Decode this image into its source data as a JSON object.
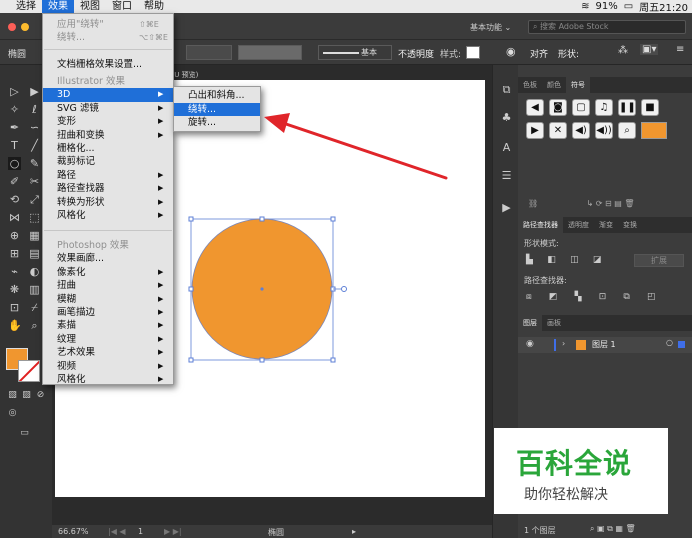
{
  "menubar": {
    "items": [
      "选择",
      "效果",
      "视图",
      "窗口",
      "帮助"
    ],
    "status": {
      "battery": "91%",
      "clock": "周五21:20"
    }
  },
  "titlebar": {
    "workspace": "基本功能 ⌄",
    "search_placeholder": "搜索 Adobe Stock"
  },
  "controlbar": {
    "tool_name": "椭圆",
    "stroke_style": "基本",
    "opacity_label": "不透明度",
    "style_label": "样式:",
    "align_label": "对齐",
    "shape_label": "形状:"
  },
  "doc_tab": "PU 预览)",
  "effect_menu": {
    "items": [
      {
        "label": "应用\"绕转\"",
        "shortcut": "⇧⌘E",
        "disabled": true
      },
      {
        "label": "绕转...",
        "shortcut": "⌥⇧⌘E",
        "disabled": true
      },
      {
        "label": "文档栅格效果设置..."
      },
      {
        "label": "Illustrator 效果",
        "disabled": true
      },
      {
        "label": "3D",
        "submenu": true,
        "highlighted": true
      },
      {
        "label": "SVG 滤镜",
        "submenu": true
      },
      {
        "label": "变形",
        "submenu": true
      },
      {
        "label": "扭曲和变换",
        "submenu": true
      },
      {
        "label": "栅格化..."
      },
      {
        "label": "裁剪标记"
      },
      {
        "label": "路径",
        "submenu": true
      },
      {
        "label": "路径查找器",
        "submenu": true
      },
      {
        "label": "转换为形状",
        "submenu": true
      },
      {
        "label": "风格化",
        "submenu": true
      },
      {
        "label": "Photoshop 效果",
        "disabled": true
      },
      {
        "label": "效果画廊..."
      },
      {
        "label": "像素化",
        "submenu": true
      },
      {
        "label": "扭曲",
        "submenu": true
      },
      {
        "label": "模糊",
        "submenu": true
      },
      {
        "label": "画笔描边",
        "submenu": true
      },
      {
        "label": "素描",
        "submenu": true
      },
      {
        "label": "纹理",
        "submenu": true
      },
      {
        "label": "艺术效果",
        "submenu": true
      },
      {
        "label": "视频",
        "submenu": true
      },
      {
        "label": "风格化",
        "submenu": true
      }
    ]
  },
  "submenu_3d": {
    "items": [
      {
        "label": "凸出和斜角..."
      },
      {
        "label": "绕转...",
        "highlighted": true
      },
      {
        "label": "旋转..."
      }
    ]
  },
  "artwork": {
    "fill": "#F0962F",
    "stroke": "#7a86b8"
  },
  "fill_swatch": "#F0962F",
  "panels": {
    "top_tabs": [
      "色板",
      "颜色",
      "符号"
    ],
    "pathfinder_tabs": [
      "路径查找器",
      "透明度",
      "渐变",
      "变换"
    ],
    "shape_modes_label": "形状模式:",
    "expand_label": "扩展",
    "pathfinders_label": "路径查找器:",
    "layer_tabs": [
      "图层",
      "画板"
    ],
    "layer_name": "图层 1",
    "layer_count": "1 个图层"
  },
  "statusbar": {
    "zoom": "66.67%",
    "page": "1",
    "tool": "椭圆"
  },
  "watermark": {
    "title": "百科全说",
    "subtitle": "助你轻松解决"
  },
  "colors": {
    "highlight": "#1f6fd8",
    "arrow": "#e0252a",
    "watermark_green": "#2aa63a"
  }
}
